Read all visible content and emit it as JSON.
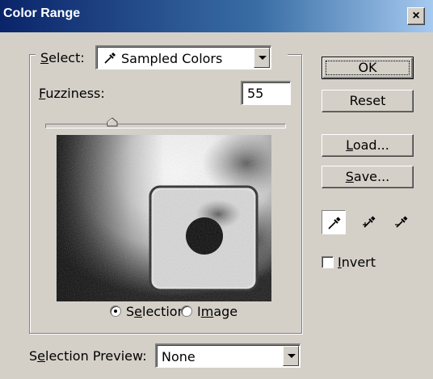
{
  "window": {
    "title": "Color Range",
    "close_glyph": "×"
  },
  "select": {
    "label_prefix": "",
    "label_access": "S",
    "label_rest": "elect:",
    "value": "Sampled Colors",
    "icon": "eyedropper-icon"
  },
  "fuzziness": {
    "label_access": "F",
    "label_rest": "uzziness:",
    "value": "55",
    "slider_fraction": 0.28
  },
  "view_options": {
    "selection": {
      "pre": "S",
      "access": "e",
      "post": "lection",
      "checked": true
    },
    "image": {
      "pre": "I",
      "access": "m",
      "post": "age",
      "checked": false
    }
  },
  "selection_preview": {
    "pre": "S",
    "access": "e",
    "post": "lection Preview:",
    "value": "None"
  },
  "buttons": {
    "ok": "OK",
    "reset": "Reset",
    "load_access": "L",
    "load_rest": "oad...",
    "save_access": "S",
    "save_rest": "ave..."
  },
  "eyedroppers": [
    {
      "name": "eyedropper-icon",
      "pressed": true
    },
    {
      "name": "eyedropper-plus-icon",
      "pressed": false
    },
    {
      "name": "eyedropper-minus-icon",
      "pressed": false
    }
  ],
  "invert": {
    "access": "I",
    "rest": "nvert",
    "checked": false
  }
}
